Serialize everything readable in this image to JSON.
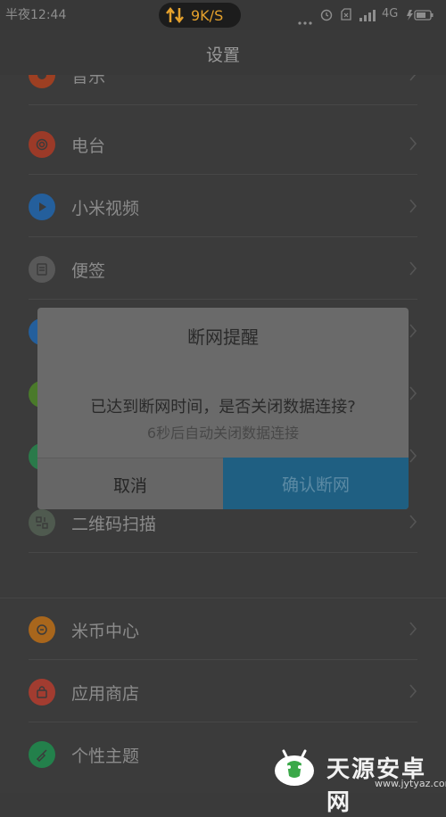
{
  "status_bar": {
    "time": "半夜12:44",
    "speed": "9K/S",
    "network": "4G",
    "speed_color": "#e5a12c"
  },
  "header": {
    "title": "设置"
  },
  "list": {
    "items": [
      {
        "label": "音乐",
        "icon": "music-icon",
        "color": "#b94b2a"
      },
      {
        "label": "电台",
        "icon": "radio-icon",
        "color": "#b3442e"
      },
      {
        "label": "小米视频",
        "icon": "play-icon",
        "color": "#2a6fb8"
      },
      {
        "label": "便签",
        "icon": "note-icon",
        "color": "#7a7a7a"
      },
      {
        "label": "二维码扫描",
        "icon": "qrcode-icon",
        "color": "#6e7a6e"
      },
      {
        "label": "米币中心",
        "icon": "coin-icon",
        "color": "#c97d22"
      },
      {
        "label": "应用商店",
        "icon": "shopping-bag-icon",
        "color": "#c24a3a"
      },
      {
        "label": "个性主题",
        "icon": "brush-icon",
        "color": "#2a9a5a"
      }
    ]
  },
  "dialog": {
    "title": "断网提醒",
    "message": "已达到断网时间，是否关闭数据连接?",
    "countdown": "6秒后自动关闭数据连接",
    "cancel_label": "取消",
    "confirm_label": "确认断网"
  },
  "watermark": {
    "name": "天源安卓网",
    "url": "www.jytyaz.com"
  }
}
